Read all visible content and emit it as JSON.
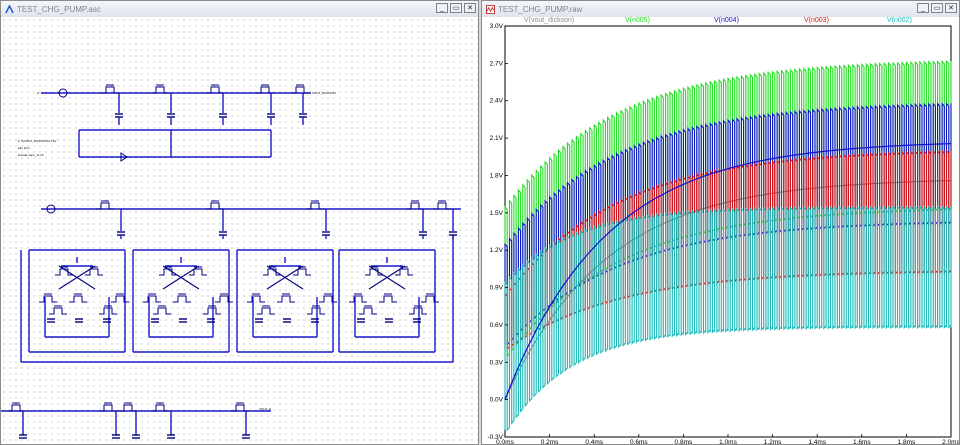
{
  "schematic_window": {
    "title": "TEST_CHG_PUMP.asc",
    "buttons": {
      "minimize": "_",
      "restore": "▭",
      "close": "✕"
    },
    "directives": [
      ".ic V(VOUT_DICKSON)=1.5V",
      ".tran 2ms",
      ".include nano_v1.lib"
    ],
    "net_labels": {
      "in": "in",
      "vout": "VOUT_DICKSON",
      "vout2": "VOUT_E"
    }
  },
  "waveform_window": {
    "title": "TEST_CHG_PUMP.raw",
    "buttons": {
      "minimize": "_",
      "restore": "▭",
      "close": "✕"
    }
  },
  "chart_data": {
    "type": "line",
    "xlabel": "",
    "ylabel": "",
    "x_ticks": [
      "0.0ms",
      "0.2ms",
      "0.4ms",
      "0.6ms",
      "0.8ms",
      "1.0ms",
      "1.2ms",
      "1.4ms",
      "1.6ms",
      "1.8ms",
      "2.0ms"
    ],
    "y_ticks": [
      "-0.3V",
      "0.0V",
      "0.3V",
      "0.6V",
      "0.9V",
      "1.2V",
      "1.5V",
      "1.8V",
      "2.1V",
      "2.4V",
      "2.7V",
      "3.0V"
    ],
    "xlim": [
      0,
      2.0
    ],
    "ylim": [
      -0.3,
      3.0
    ],
    "grid": false,
    "series": [
      {
        "name": "V(vout_dickson)",
        "color": "#8c8c8c",
        "kind": "smooth",
        "end": 1.78,
        "tau": 0.45
      },
      {
        "name": "V(n005)",
        "color": "#22dd22",
        "kind": "ripple",
        "hi_start": 1.5,
        "hi_end": 2.74,
        "lo_start": 0.3,
        "lo_end": 1.54,
        "tau": 0.5
      },
      {
        "name": "V(n004)",
        "color": "#1010cc",
        "kind": "ripple",
        "hi_start": 1.2,
        "hi_end": 2.4,
        "lo_start": 0.4,
        "lo_end": 1.43,
        "tau": 0.5
      },
      {
        "name": "V(n003)",
        "color": "#e01010",
        "kind": "ripple",
        "hi_start": 0.8,
        "hi_end": 2.02,
        "lo_start": 0.38,
        "lo_end": 1.03,
        "tau": 0.5
      },
      {
        "name": "V(n002)",
        "color": "#1ab8b8",
        "kind": "ripple",
        "hi_start": 0.9,
        "hi_end": 1.55,
        "lo_start": -0.3,
        "lo_end": 0.58,
        "tau": 0.3
      },
      {
        "name": "",
        "color": "#1010cc",
        "kind": "smooth",
        "end": 2.08,
        "tau": 0.45
      }
    ]
  }
}
